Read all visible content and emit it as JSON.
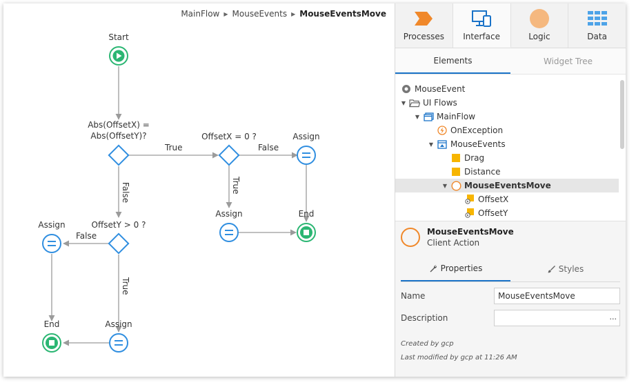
{
  "breadcrumb": {
    "items": [
      "MainFlow",
      "MouseEvents"
    ],
    "current": "MouseEventsMove"
  },
  "flow": {
    "start_label": "Start",
    "if1_label_line1": "Abs(OffsetX) =",
    "if1_label_line2": "Abs(OffsetY)?",
    "if2_label": "OffsetX = 0 ?",
    "if3_label": "OffsetY > 0 ?",
    "assign_label": "Assign",
    "end_label": "End",
    "true_label": "True",
    "false_label": "False"
  },
  "panel": {
    "main_tabs": [
      "Processes",
      "Interface",
      "Logic",
      "Data"
    ],
    "active_main_tab": "Interface",
    "sub_tabs": [
      "Elements",
      "Widget Tree"
    ],
    "tree": [
      {
        "label": "MouseEvent",
        "icon": "module-icon"
      },
      {
        "label": "UI Flows",
        "icon": "folder-open-icon"
      },
      {
        "label": "MainFlow",
        "icon": "flow-icon"
      },
      {
        "label": "OnException",
        "icon": "exception-icon"
      },
      {
        "label": "MouseEvents",
        "icon": "screen-icon"
      },
      {
        "label": "Drag",
        "icon": "variable-icon"
      },
      {
        "label": "Distance",
        "icon": "variable-icon"
      },
      {
        "label": "MouseEventsMove",
        "icon": "client-action-icon"
      },
      {
        "label": "OffsetX",
        "icon": "input-parameter-icon"
      },
      {
        "label": "OffsetY",
        "icon": "input-parameter-icon"
      }
    ],
    "selected": {
      "name": "MouseEventsMove",
      "type": "Client Action"
    },
    "prop_tabs": [
      "Properties",
      "Styles"
    ],
    "properties": {
      "name_label": "Name",
      "name_value": "MouseEventsMove",
      "description_label": "Description",
      "description_value": "",
      "description_button": "..."
    },
    "meta": {
      "created": "Created by gcp",
      "modified": "Last modified by gcp at 11:26 AM"
    }
  },
  "colors": {
    "start_green": "#2bb673",
    "if_blue": "#2f8ee0",
    "assign_blue": "#2f8ee0",
    "end_green": "#2bb673",
    "connector": "#9b9b9b",
    "accent": "#1a73c8",
    "action_orange": "#f0882a"
  }
}
